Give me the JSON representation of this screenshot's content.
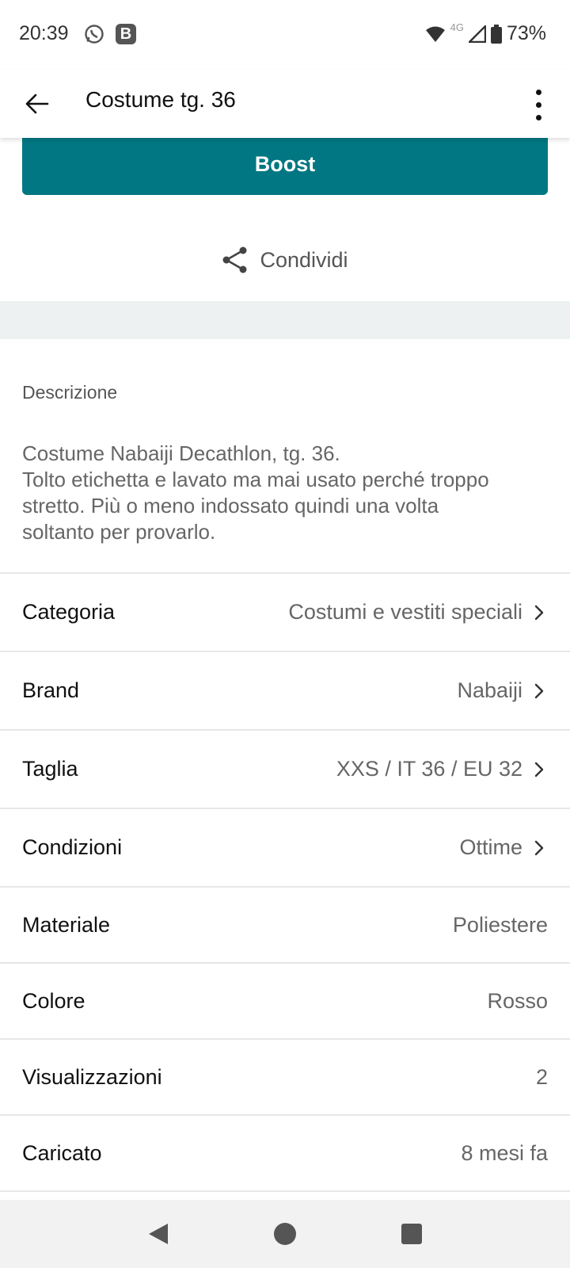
{
  "status_bar": {
    "time": "20:39",
    "battery": "73%",
    "network": "4G",
    "b_badge": "B"
  },
  "app_bar": {
    "title": "Costume tg. 36"
  },
  "boost": {
    "label": "Boost",
    "color": "#007782"
  },
  "share": {
    "label": "Condividi"
  },
  "description": {
    "heading": "Descrizione",
    "lines": [
      "Costume Nabaiji Decathlon, tg. 36.",
      "Tolto etichetta e lavato ma mai usato perché troppo",
      "stretto. Più o meno indossato quindi una volta",
      "soltanto per provarlo."
    ]
  },
  "details": [
    {
      "label": "Categoria",
      "value": "Costumi e vestiti speciali"
    },
    {
      "label": "Brand",
      "value": "Nabaiji"
    },
    {
      "label": "Taglia",
      "value": "XXS / IT 36 / EU 32"
    },
    {
      "label": "Condizioni",
      "value": "Ottime"
    },
    {
      "label": "Materiale",
      "value": "Poliestere"
    },
    {
      "label": "Colore",
      "value": "Rosso"
    },
    {
      "label": "Visualizzazioni",
      "value": "2"
    },
    {
      "label": "Caricato",
      "value": "8 mesi fa"
    }
  ]
}
